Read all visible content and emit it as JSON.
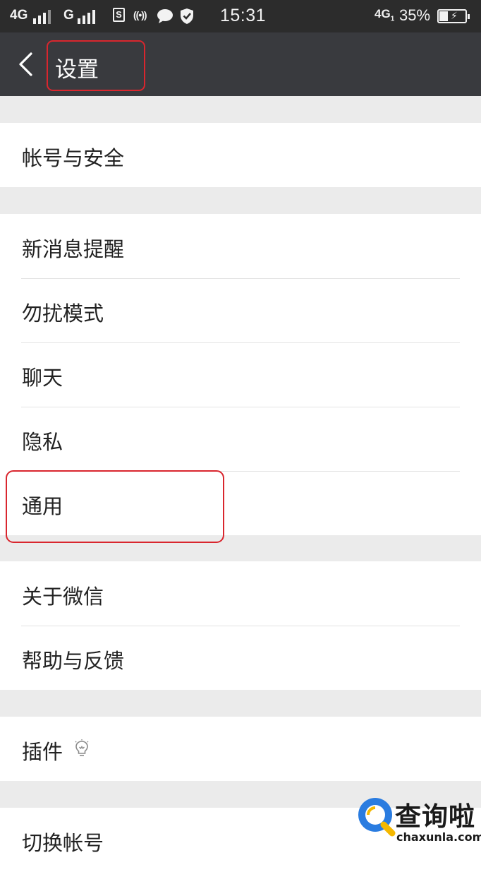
{
  "status_bar": {
    "network1": "4G",
    "network2": "G",
    "sim_badge": "S",
    "time": "15:31",
    "network3": "4G",
    "network3_sub": "1",
    "battery": "35%"
  },
  "header": {
    "title": "设置"
  },
  "groups": [
    {
      "items": [
        {
          "label": "帐号与安全"
        }
      ]
    },
    {
      "items": [
        {
          "label": "新消息提醒"
        },
        {
          "label": "勿扰模式"
        },
        {
          "label": "聊天"
        },
        {
          "label": "隐私"
        },
        {
          "label": "通用"
        }
      ]
    },
    {
      "items": [
        {
          "label": "关于微信"
        },
        {
          "label": "帮助与反馈"
        }
      ]
    },
    {
      "items": [
        {
          "label": "插件",
          "icon": "lightbulb-icon"
        }
      ]
    },
    {
      "items": [
        {
          "label": "切换帐号"
        }
      ]
    }
  ],
  "watermark": {
    "text": "查询啦",
    "domain": "chaxunla.com"
  },
  "colors": {
    "statusbar_bg": "#2c2c2c",
    "titlebar_bg": "#393a3e",
    "page_bg": "#ebebeb",
    "highlight": "#d9262e",
    "watermark_blue": "#2a7ce0",
    "watermark_yellow": "#f5b800"
  }
}
